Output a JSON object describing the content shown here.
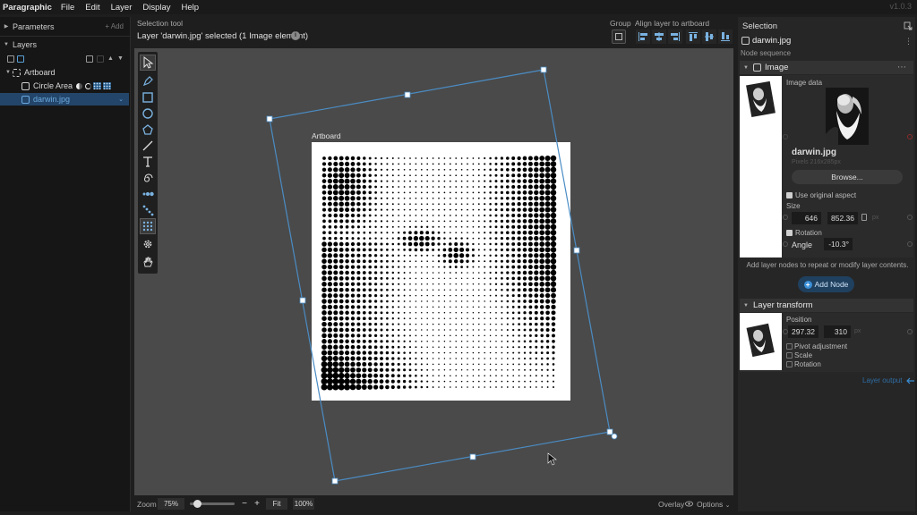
{
  "menu": {
    "app_name": "Paragraphic",
    "items": [
      "File",
      "Edit",
      "Layer",
      "Display",
      "Help"
    ],
    "version": "v1.0.3"
  },
  "left_panel": {
    "parameters_title": "Parameters",
    "add_label": "+ Add",
    "layers_title": "Layers",
    "layers": [
      {
        "label": "Artboard",
        "icon": "artboard-icon",
        "selected": false
      },
      {
        "label": "Circle Area",
        "icon": "node-icon",
        "selected": false
      },
      {
        "label": "darwin.jpg",
        "icon": "image-node-icon",
        "selected": true
      }
    ]
  },
  "toolbar": {
    "tool_label": "Selection tool",
    "status": "Layer 'darwin.jpg' selected (1 Image element)",
    "group_label": "Group",
    "align_label": "Align layer to artboard"
  },
  "canvas": {
    "artboard_label": "Artboard",
    "accent_color": "#4a8cc4"
  },
  "tools": [
    "select-tool-icon",
    "pen-tool-icon",
    "rectangle-tool-icon",
    "ellipse-tool-icon",
    "polygon-tool-icon",
    "line-tool-icon",
    "text-tool-icon",
    "spiral-tool-icon",
    "repeat-tool-icon",
    "path-tool-icon",
    "grid-tool-icon",
    "gear-tool-icon",
    "hand-tool-icon"
  ],
  "bottom_bar": {
    "zoom_label": "Zoom",
    "zoom_value": "75%",
    "zoom_slider_level": 0.15,
    "minus": "−",
    "plus": "+",
    "fit_label": "Fit",
    "zoom_100_label": "100%",
    "overlay_label": "Overlay",
    "options_label": "Options"
  },
  "right_panel": {
    "selection_title": "Selection",
    "selected_name": "darwin.jpg",
    "node_sequence_label": "Node sequence",
    "image_node": {
      "title": "Image",
      "image_data_label": "Image data",
      "file_name": "darwin.jpg",
      "pixel_info": "Pixels 216x285px",
      "browse_label": "Browse...",
      "use_original_aspect_label": "Use original aspect",
      "size_label": "Size",
      "size_w": "646",
      "size_h": "852.36",
      "size_unit": "px",
      "rotation_label": "Rotation",
      "angle_label": "Angle",
      "angle_value": "-10.3°"
    },
    "add_layer_hint": "Add layer nodes to repeat or modify layer contents.",
    "add_node_label": "Add Node",
    "transform_node": {
      "title": "Layer transform",
      "position_label": "Position",
      "pos_x": "297.32",
      "pos_y": "310",
      "pos_unit": "px",
      "pivot_label": "Pivot adjustment",
      "scale_label": "Scale",
      "rotation_label": "Rotation"
    },
    "layer_output_label": "Layer output"
  }
}
